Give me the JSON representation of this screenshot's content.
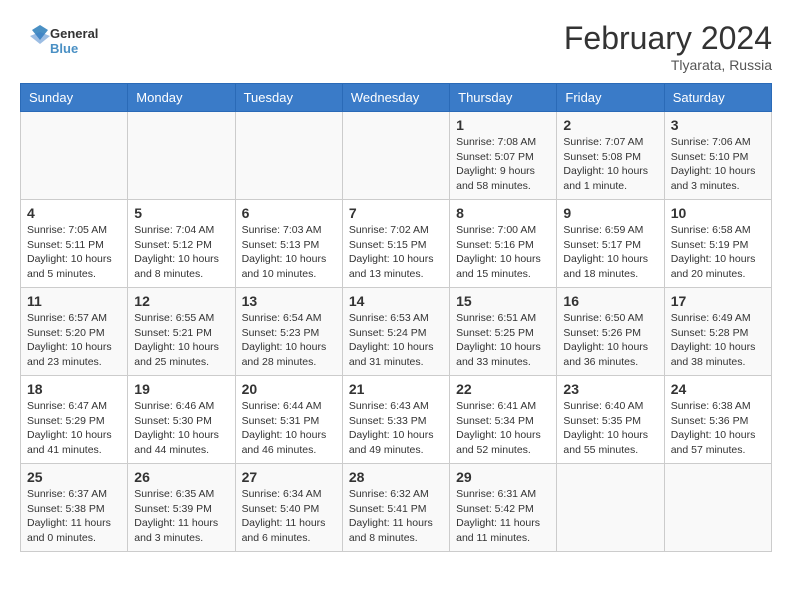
{
  "header": {
    "logo_general": "General",
    "logo_blue": "Blue",
    "month_year": "February 2024",
    "location": "Tlyarata, Russia"
  },
  "weekdays": [
    "Sunday",
    "Monday",
    "Tuesday",
    "Wednesday",
    "Thursday",
    "Friday",
    "Saturday"
  ],
  "weeks": [
    [
      null,
      null,
      null,
      null,
      {
        "day": 1,
        "sunrise": "7:08 AM",
        "sunset": "5:07 PM",
        "daylight": "9 hours and 58 minutes."
      },
      {
        "day": 2,
        "sunrise": "7:07 AM",
        "sunset": "5:08 PM",
        "daylight": "10 hours and 1 minute."
      },
      {
        "day": 3,
        "sunrise": "7:06 AM",
        "sunset": "5:10 PM",
        "daylight": "10 hours and 3 minutes."
      }
    ],
    [
      {
        "day": 4,
        "sunrise": "7:05 AM",
        "sunset": "5:11 PM",
        "daylight": "10 hours and 5 minutes."
      },
      {
        "day": 5,
        "sunrise": "7:04 AM",
        "sunset": "5:12 PM",
        "daylight": "10 hours and 8 minutes."
      },
      {
        "day": 6,
        "sunrise": "7:03 AM",
        "sunset": "5:13 PM",
        "daylight": "10 hours and 10 minutes."
      },
      {
        "day": 7,
        "sunrise": "7:02 AM",
        "sunset": "5:15 PM",
        "daylight": "10 hours and 13 minutes."
      },
      {
        "day": 8,
        "sunrise": "7:00 AM",
        "sunset": "5:16 PM",
        "daylight": "10 hours and 15 minutes."
      },
      {
        "day": 9,
        "sunrise": "6:59 AM",
        "sunset": "5:17 PM",
        "daylight": "10 hours and 18 minutes."
      },
      {
        "day": 10,
        "sunrise": "6:58 AM",
        "sunset": "5:19 PM",
        "daylight": "10 hours and 20 minutes."
      }
    ],
    [
      {
        "day": 11,
        "sunrise": "6:57 AM",
        "sunset": "5:20 PM",
        "daylight": "10 hours and 23 minutes."
      },
      {
        "day": 12,
        "sunrise": "6:55 AM",
        "sunset": "5:21 PM",
        "daylight": "10 hours and 25 minutes."
      },
      {
        "day": 13,
        "sunrise": "6:54 AM",
        "sunset": "5:23 PM",
        "daylight": "10 hours and 28 minutes."
      },
      {
        "day": 14,
        "sunrise": "6:53 AM",
        "sunset": "5:24 PM",
        "daylight": "10 hours and 31 minutes."
      },
      {
        "day": 15,
        "sunrise": "6:51 AM",
        "sunset": "5:25 PM",
        "daylight": "10 hours and 33 minutes."
      },
      {
        "day": 16,
        "sunrise": "6:50 AM",
        "sunset": "5:26 PM",
        "daylight": "10 hours and 36 minutes."
      },
      {
        "day": 17,
        "sunrise": "6:49 AM",
        "sunset": "5:28 PM",
        "daylight": "10 hours and 38 minutes."
      }
    ],
    [
      {
        "day": 18,
        "sunrise": "6:47 AM",
        "sunset": "5:29 PM",
        "daylight": "10 hours and 41 minutes."
      },
      {
        "day": 19,
        "sunrise": "6:46 AM",
        "sunset": "5:30 PM",
        "daylight": "10 hours and 44 minutes."
      },
      {
        "day": 20,
        "sunrise": "6:44 AM",
        "sunset": "5:31 PM",
        "daylight": "10 hours and 46 minutes."
      },
      {
        "day": 21,
        "sunrise": "6:43 AM",
        "sunset": "5:33 PM",
        "daylight": "10 hours and 49 minutes."
      },
      {
        "day": 22,
        "sunrise": "6:41 AM",
        "sunset": "5:34 PM",
        "daylight": "10 hours and 52 minutes."
      },
      {
        "day": 23,
        "sunrise": "6:40 AM",
        "sunset": "5:35 PM",
        "daylight": "10 hours and 55 minutes."
      },
      {
        "day": 24,
        "sunrise": "6:38 AM",
        "sunset": "5:36 PM",
        "daylight": "10 hours and 57 minutes."
      }
    ],
    [
      {
        "day": 25,
        "sunrise": "6:37 AM",
        "sunset": "5:38 PM",
        "daylight": "11 hours and 0 minutes."
      },
      {
        "day": 26,
        "sunrise": "6:35 AM",
        "sunset": "5:39 PM",
        "daylight": "11 hours and 3 minutes."
      },
      {
        "day": 27,
        "sunrise": "6:34 AM",
        "sunset": "5:40 PM",
        "daylight": "11 hours and 6 minutes."
      },
      {
        "day": 28,
        "sunrise": "6:32 AM",
        "sunset": "5:41 PM",
        "daylight": "11 hours and 8 minutes."
      },
      {
        "day": 29,
        "sunrise": "6:31 AM",
        "sunset": "5:42 PM",
        "daylight": "11 hours and 11 minutes."
      },
      null,
      null
    ]
  ]
}
